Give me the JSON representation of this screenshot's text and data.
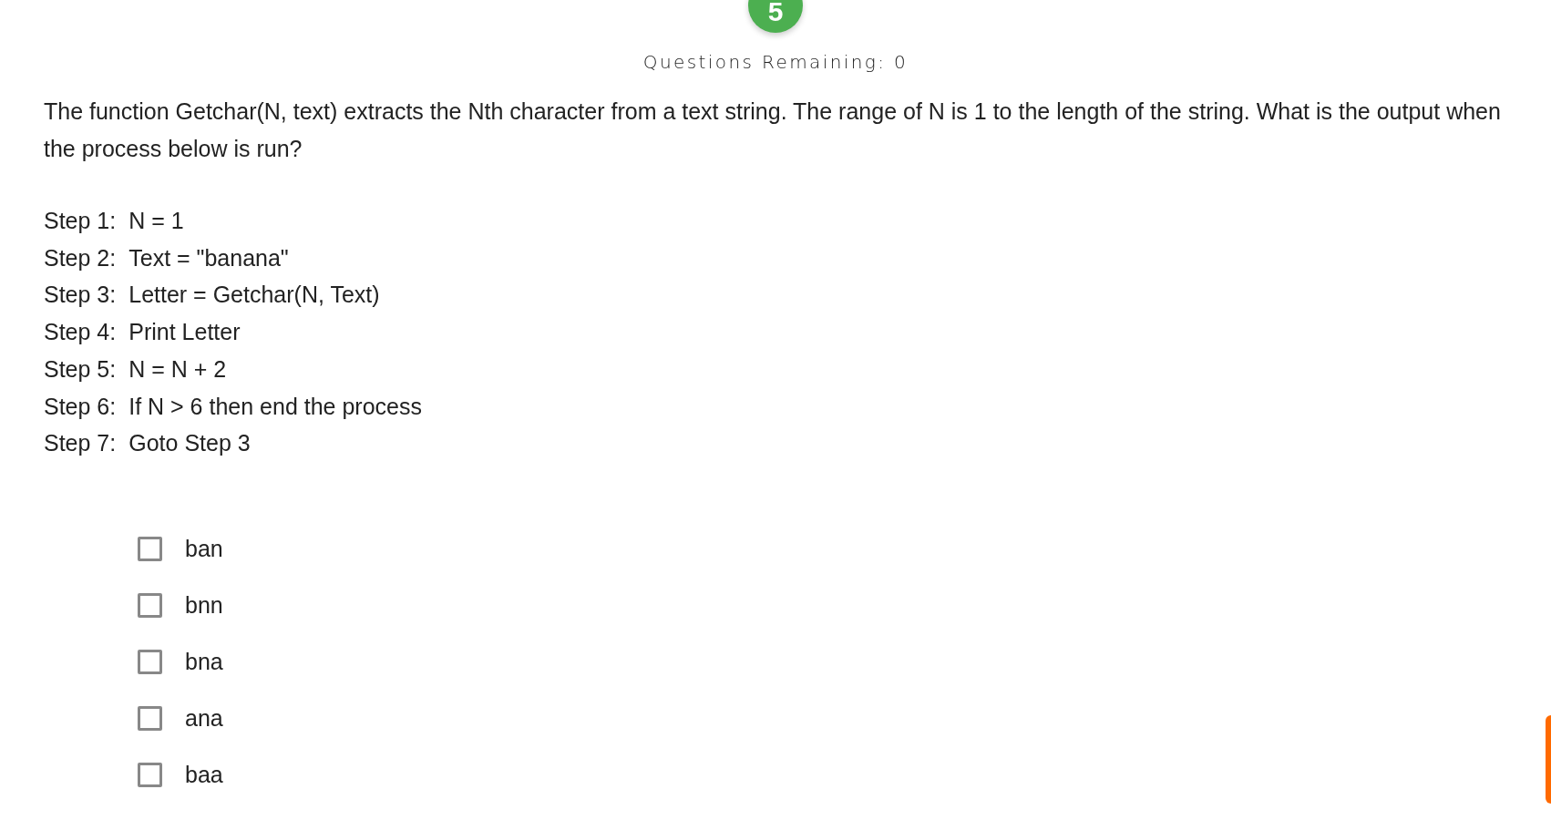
{
  "badge": {
    "number": "5"
  },
  "remaining": "Questions Remaining: 0",
  "question": "The function Getchar(N, text) extracts the Nth character from a text string. The range of N is 1 to the length of the string. What is the output when the process below is run?",
  "steps": [
    {
      "label": "Step 1:",
      "text": "N = 1"
    },
    {
      "label": "Step 2:",
      "text": "Text = \"banana\""
    },
    {
      "label": "Step 3:",
      "text": "Letter = Getchar(N, Text)"
    },
    {
      "label": "Step 4:",
      "text": "Print Letter"
    },
    {
      "label": "Step 5:",
      "text": "N = N + 2"
    },
    {
      "label": "Step 6:",
      "text": "If N > 6 then end the process"
    },
    {
      "label": "Step 7:",
      "text": "Goto Step 3"
    }
  ],
  "options": [
    {
      "label": "ban",
      "checked": false
    },
    {
      "label": "bnn",
      "checked": false
    },
    {
      "label": "bna",
      "checked": false
    },
    {
      "label": "ana",
      "checked": false
    },
    {
      "label": "baa",
      "checked": false
    }
  ]
}
